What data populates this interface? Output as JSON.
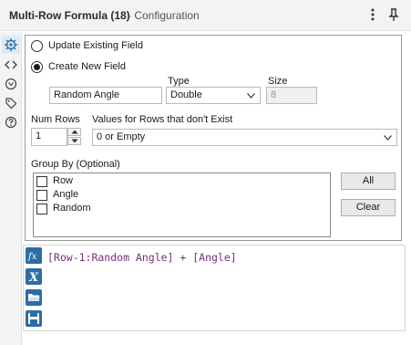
{
  "header": {
    "title": "Multi-Row Formula (18)",
    "subtitle": "- Configuration"
  },
  "sidebar": {
    "icons": [
      "gear-icon",
      "code-icon",
      "settings-circle-icon",
      "tag-icon",
      "help-icon"
    ]
  },
  "config": {
    "update_existing_label": "Update Existing Field",
    "create_new_label": "Create New  Field",
    "selected_mode": "create_new",
    "field_name_value": "Random Angle",
    "type_label": "Type",
    "type_value": "Double",
    "size_label": "Size",
    "size_value": "8",
    "num_rows_label": "Num Rows",
    "num_rows_value": "1",
    "values_label": "Values for Rows that don't Exist",
    "values_value": "0 or Empty",
    "group_by_label": "Group By (Optional)",
    "group_by_items": [
      {
        "label": "Row",
        "checked": false
      },
      {
        "label": "Angle",
        "checked": false
      },
      {
        "label": "Random",
        "checked": false
      }
    ],
    "all_button": "All",
    "clear_button": "Clear"
  },
  "formula": {
    "expression": "[Row-1:Random Angle] + [Angle]",
    "tools": [
      "fx-icon",
      "variable-x-icon",
      "folder-open-icon",
      "save-icon"
    ]
  }
}
